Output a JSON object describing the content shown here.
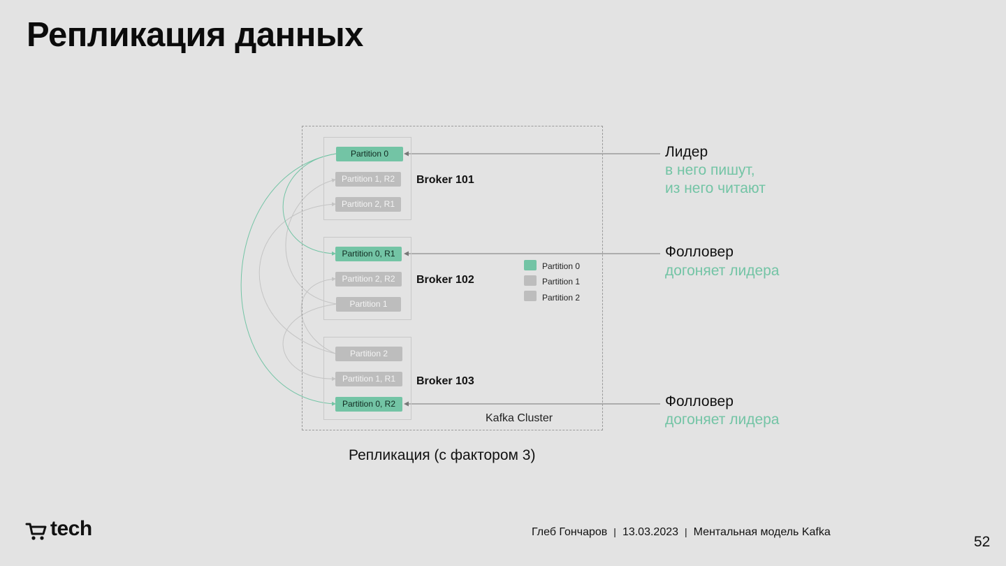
{
  "slide": {
    "title": "Репликация данных",
    "caption": "Репликация (с фактором 3)",
    "page_number": "52"
  },
  "diagram": {
    "cluster_label": "Kafka Cluster",
    "brokers": [
      {
        "label": "Broker 101",
        "partitions": [
          {
            "label": "Partition 0",
            "role": "leader"
          },
          {
            "label": "Partition 1, R2",
            "role": "replica"
          },
          {
            "label": "Partition 2, R1",
            "role": "replica"
          }
        ]
      },
      {
        "label": "Broker 102",
        "partitions": [
          {
            "label": "Partition 0, R1",
            "role": "leader"
          },
          {
            "label": "Partition 2, R2",
            "role": "replica"
          },
          {
            "label": "Partition 1",
            "role": "replica"
          }
        ]
      },
      {
        "label": "Broker 103",
        "partitions": [
          {
            "label": "Partition 2",
            "role": "replica"
          },
          {
            "label": "Partition 1, R1",
            "role": "replica"
          },
          {
            "label": "Partition 0, R2",
            "role": "leader"
          }
        ]
      }
    ],
    "legend": [
      {
        "label": "Partition 0",
        "color": "#73c4a5"
      },
      {
        "label": "Partition 1",
        "color": "#bdbdbd"
      },
      {
        "label": "Partition 2",
        "color": "#bdbdbd"
      }
    ]
  },
  "annotations": [
    {
      "head": "Лидер",
      "sub": [
        "в него пишут,",
        "из него читают"
      ]
    },
    {
      "head": "Фолловер",
      "sub": [
        "догоняет лидера"
      ]
    },
    {
      "head": "Фолловер",
      "sub": [
        "догоняет лидера"
      ]
    }
  ],
  "footer": {
    "logo_text": "tech",
    "logo_icon": "cart-icon",
    "author": "Глеб Гончаров",
    "date": "13.03.2023",
    "topic": "Ментальная модель Kafka",
    "separator": "|"
  },
  "colors": {
    "background": "#e3e3e3",
    "accent": "#73c4a5",
    "replica": "#bdbdbd"
  }
}
